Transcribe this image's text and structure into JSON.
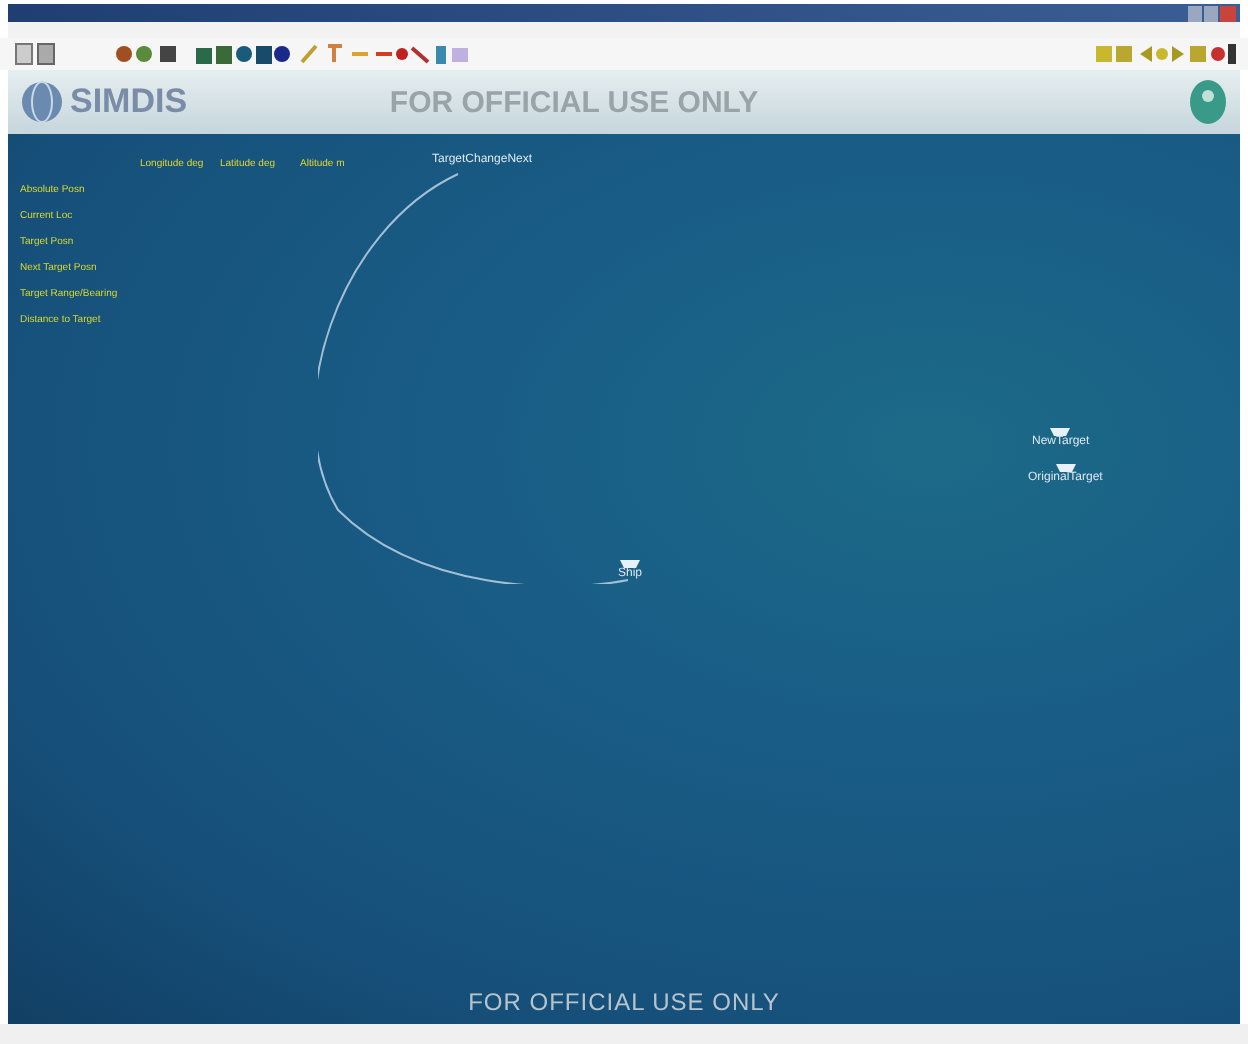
{
  "header": {
    "logo": "SIMDIS",
    "banner": "FOR OFFICIAL USE ONLY"
  },
  "hud_table": {
    "columns": [
      "Longitude deg",
      "Latitude deg",
      "Altitude m"
    ],
    "rows": [
      "Absolute Posn",
      "Current Loc",
      "Target Posn",
      "Next Target Posn",
      "Target Range/Bearing",
      "Distance to Target"
    ]
  },
  "platforms": [
    {
      "label": "TargetChangeNext",
      "kind": "label"
    },
    {
      "label": "Ship",
      "kind": "ship"
    },
    {
      "label": "NewTarget",
      "kind": "ship"
    },
    {
      "label": "OriginalTarget",
      "kind": "ship"
    }
  ],
  "footer_banner": "FOR OFFICIAL USE ONLY"
}
